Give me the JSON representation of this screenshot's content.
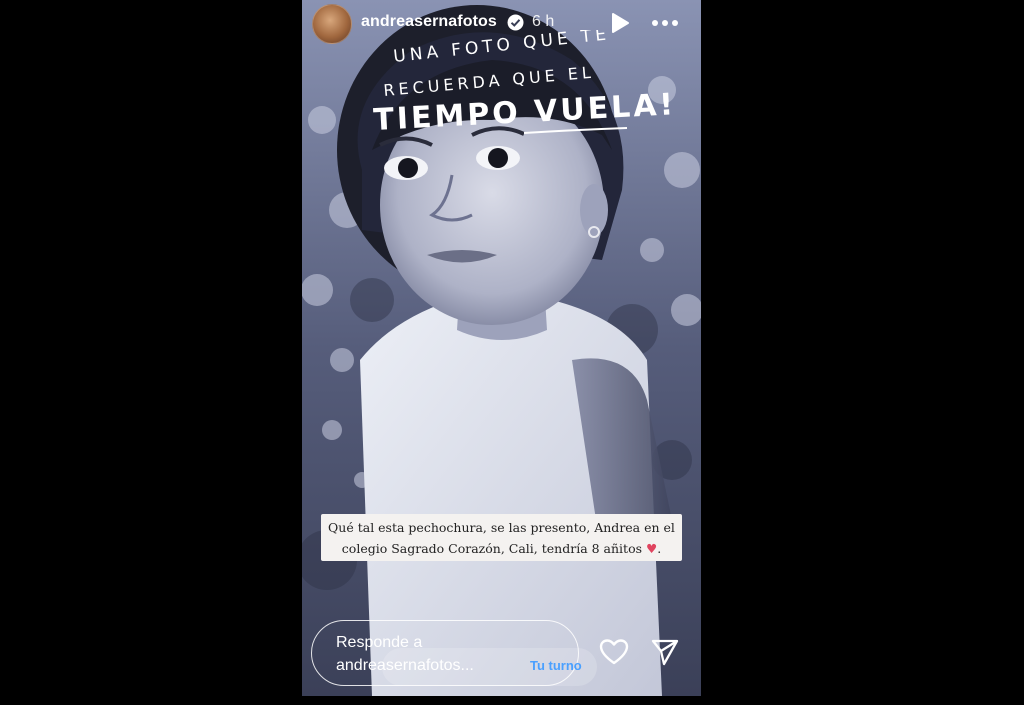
{
  "story": {
    "username": "andreasernafotos",
    "time_ago": "6 h",
    "handwritten": {
      "line1": "UNA FOTO QUE TE",
      "line2": "RECUERDA QUE EL",
      "line3": "TIEMPO VUELA!"
    },
    "caption": {
      "line1": "Qué tal esta pechochura, se las presento, Andrea en el",
      "line2": "colegio Sagrado Corazón, Cali, tendría 8 añitos",
      "emoji": "♥",
      "end": "."
    }
  },
  "footer": {
    "reply_placeholder_line1": "Responde a",
    "reply_placeholder_line2": "andreasernafotos...",
    "tu_turno": "Tu turno"
  },
  "icons": {
    "verified": "verified-badge-icon",
    "play": "play-icon",
    "more": "more-options-icon",
    "like": "heart-outline-icon",
    "share": "paper-plane-icon"
  },
  "colors": {
    "background": "#000000",
    "photo_tint": "#4a4f66",
    "link_blue": "#4aa0ff",
    "heart": "#e0445f"
  }
}
